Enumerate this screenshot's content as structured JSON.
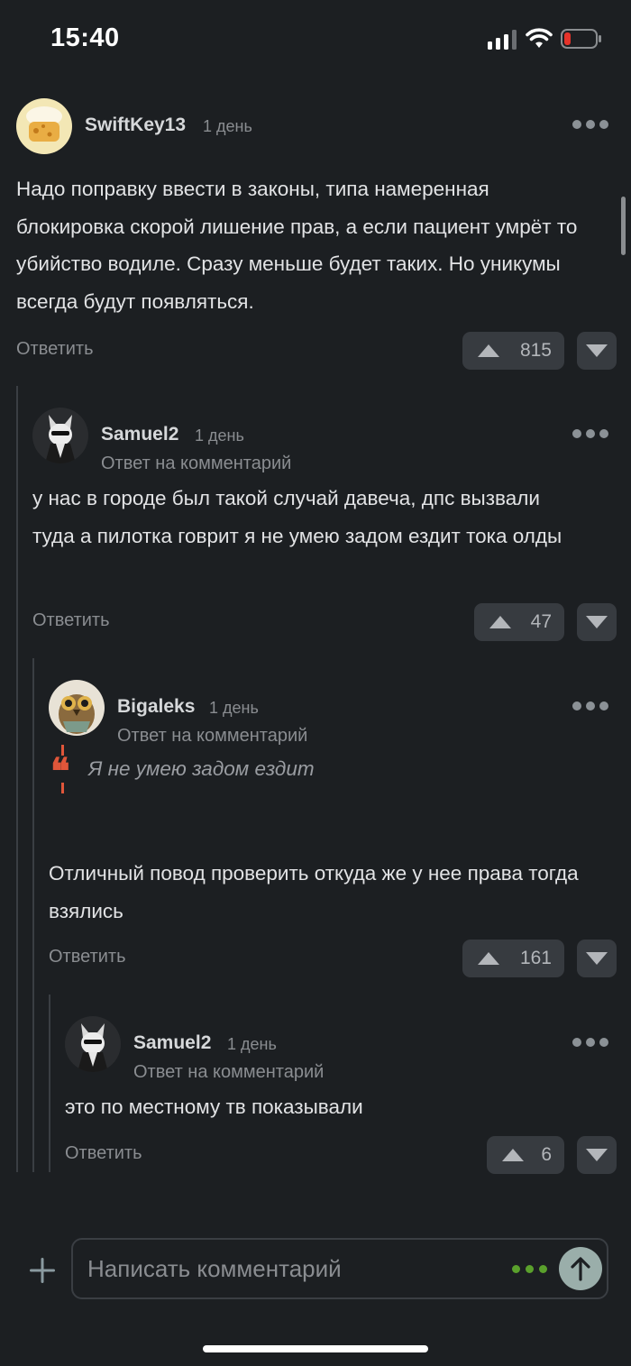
{
  "status_bar": {
    "time": "15:40"
  },
  "comments": [
    {
      "author": "SwiftKey13",
      "time": "1 день",
      "text": "Надо поправку ввести в законы, типа намеренная блокировка скорой лишение прав, а если пациент умрёт то убийство водиле. Сразу меньше будет таких. Но уникумы всегда будут появляться.",
      "reply_label": "Ответить",
      "score": "815"
    },
    {
      "author": "Samuel2",
      "time": "1 день",
      "reply_note": "Ответ на комментарий",
      "text": "у нас в городе был такой случай давеча, дпс вызвали туда а пилотка говрит я не умею задом ездит тока олды",
      "reply_label": "Ответить",
      "score": "47"
    },
    {
      "author": "Bigaleks",
      "time": "1 день",
      "reply_note": "Ответ на комментарий",
      "quote": "Я не умею задом ездит",
      "text": "Отличный повод проверить откуда же у нее права тогда взялись",
      "reply_label": "Ответить",
      "score": "161"
    },
    {
      "author": "Samuel2",
      "time": "1 день",
      "reply_note": "Ответ на комментарий",
      "text": "это по местному тв показывали",
      "reply_label": "Ответить",
      "score": "6"
    }
  ],
  "composer": {
    "placeholder": "Написать комментарий"
  },
  "icons": {
    "signal": "signal-icon",
    "wifi": "wifi-icon",
    "battery": "battery-icon",
    "more": "more-icon",
    "upvote": "upvote-icon",
    "downvote": "downvote-icon",
    "plus": "plus-icon",
    "send": "send-arrow-icon",
    "emoji": "emoji-dots-icon"
  },
  "colors": {
    "background": "#1c1f22",
    "pill": "#373b40",
    "accent_quote": "#e0563a",
    "battery_low": "#e5332a",
    "emoji_green": "#5aa02c",
    "send_bg": "#9aaeaa"
  }
}
